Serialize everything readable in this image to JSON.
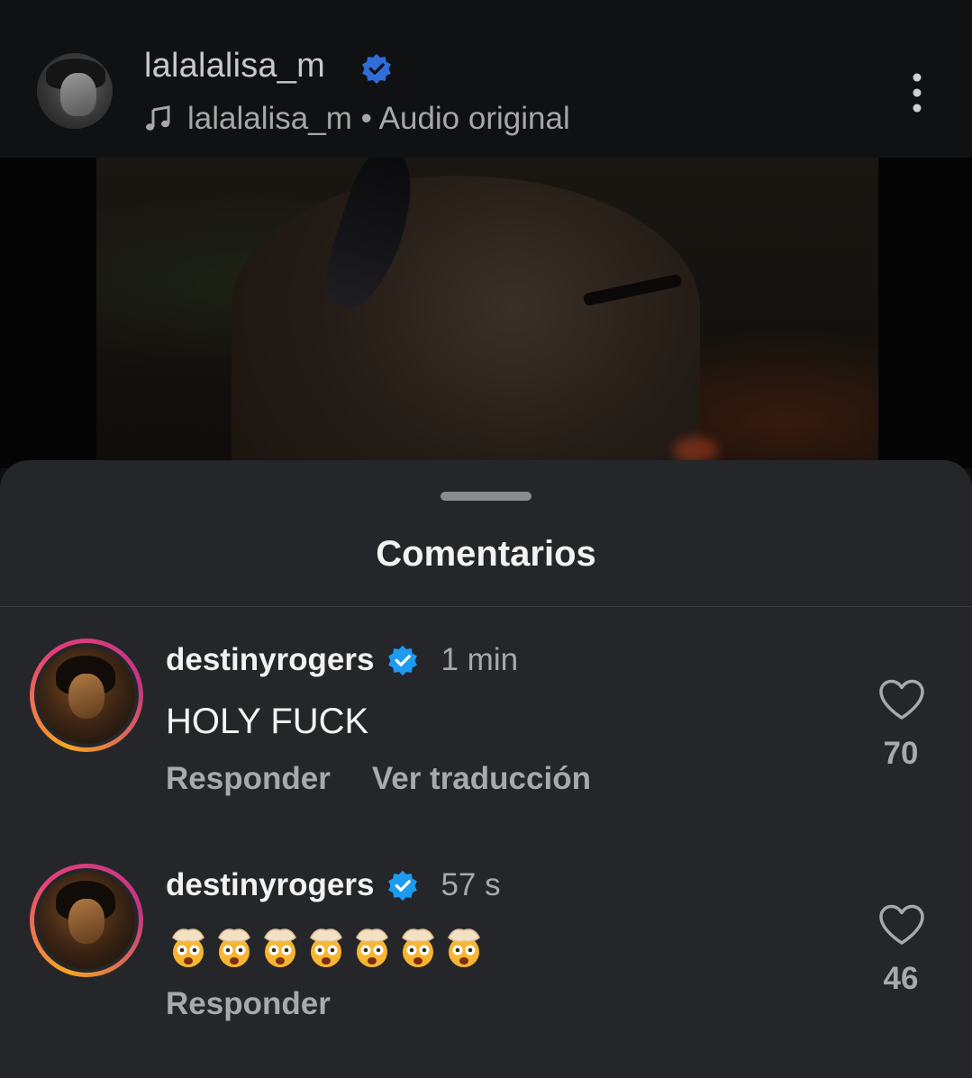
{
  "header": {
    "username": "lalalalisa_m",
    "audio_label": "lalalalisa_m • Audio original",
    "verified_icon": "verified-badge-icon",
    "music_icon": "music-note-icon",
    "more_icon": "more-vertical-icon"
  },
  "video": {
    "description": "video-frame"
  },
  "comments_sheet": {
    "title": "Comentarios",
    "comments": [
      {
        "username": "destinyrogers",
        "time": "1 min",
        "text": "HOLY FUCK",
        "reply_label": "Responder",
        "translate_label": "Ver traducción",
        "likes": "70"
      },
      {
        "username": "destinyrogers",
        "time": "57 s",
        "emoji": "🤯🤯🤯🤯🤯🤯🤯",
        "reply_label": "Responder",
        "likes": "46"
      }
    ]
  },
  "colors": {
    "verified_blue": "#1d9bf0",
    "sheet_bg": "#25262a",
    "header_bg": "#101113"
  }
}
